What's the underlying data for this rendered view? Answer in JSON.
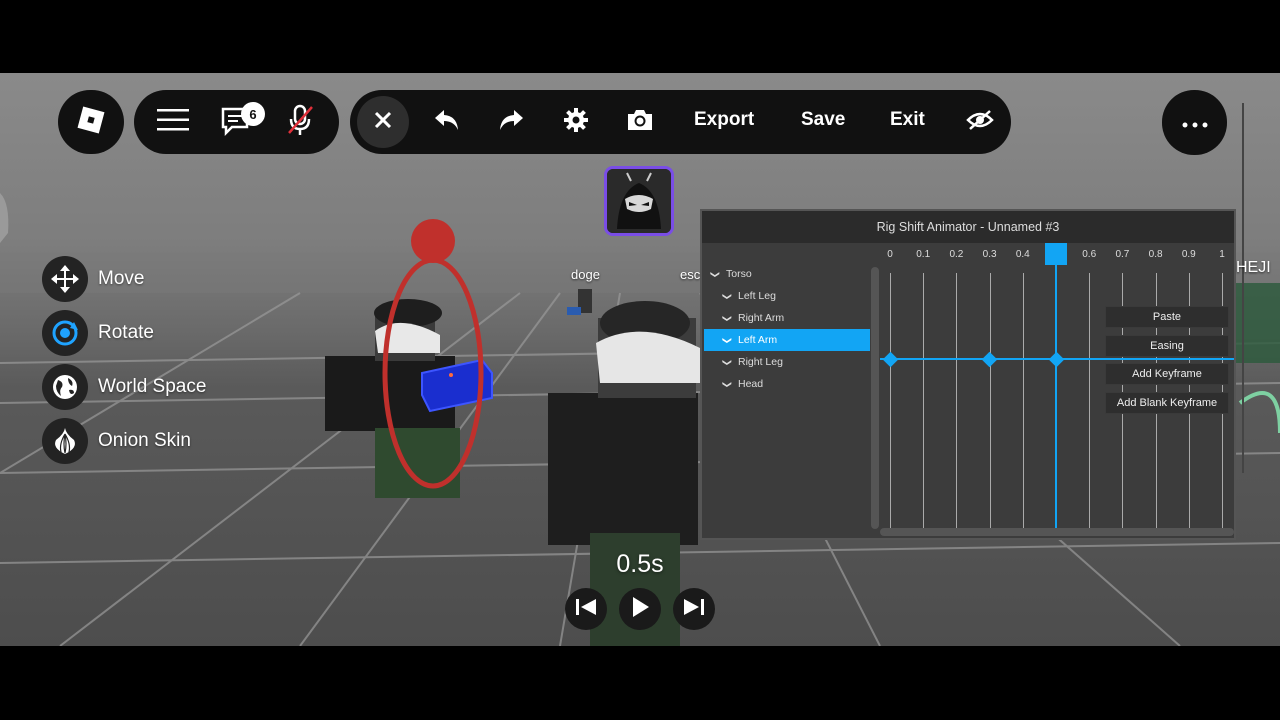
{
  "topbar": {
    "chat_badge_count": "6",
    "export_label": "Export",
    "save_label": "Save",
    "exit_label": "Exit"
  },
  "tools": [
    {
      "label": "Move",
      "icon": "move-arrows-icon"
    },
    {
      "label": "Rotate",
      "icon": "rotate-icon"
    },
    {
      "label": "World Space",
      "icon": "globe-icon"
    },
    {
      "label": "Onion Skin",
      "icon": "onion-icon"
    }
  ],
  "nametags": [
    "doge",
    "esc",
    "HEJI"
  ],
  "animator": {
    "title": "Rig Shift Animator - Unnamed #3",
    "tree": [
      {
        "label": "Torso",
        "level": 0,
        "selected": false
      },
      {
        "label": "Left Leg",
        "level": 1,
        "selected": false
      },
      {
        "label": "Right Arm",
        "level": 1,
        "selected": false
      },
      {
        "label": "Left Arm",
        "level": 1,
        "selected": true
      },
      {
        "label": "Right Leg",
        "level": 1,
        "selected": false
      },
      {
        "label": "Head",
        "level": 1,
        "selected": false
      }
    ],
    "ticks": [
      "0",
      "0.1",
      "0.2",
      "0.3",
      "0.4",
      "0.5",
      "0.6",
      "0.7",
      "0.8",
      "0.9",
      "1"
    ],
    "playhead": 0.5,
    "keyframes": [
      0,
      0.3,
      0.5
    ],
    "context_menu": [
      "Paste",
      "Easing",
      "Add Keyframe",
      "Add Blank Keyframe"
    ],
    "accent_color": "#12a5f4"
  },
  "playback": {
    "time": "0.5s"
  }
}
